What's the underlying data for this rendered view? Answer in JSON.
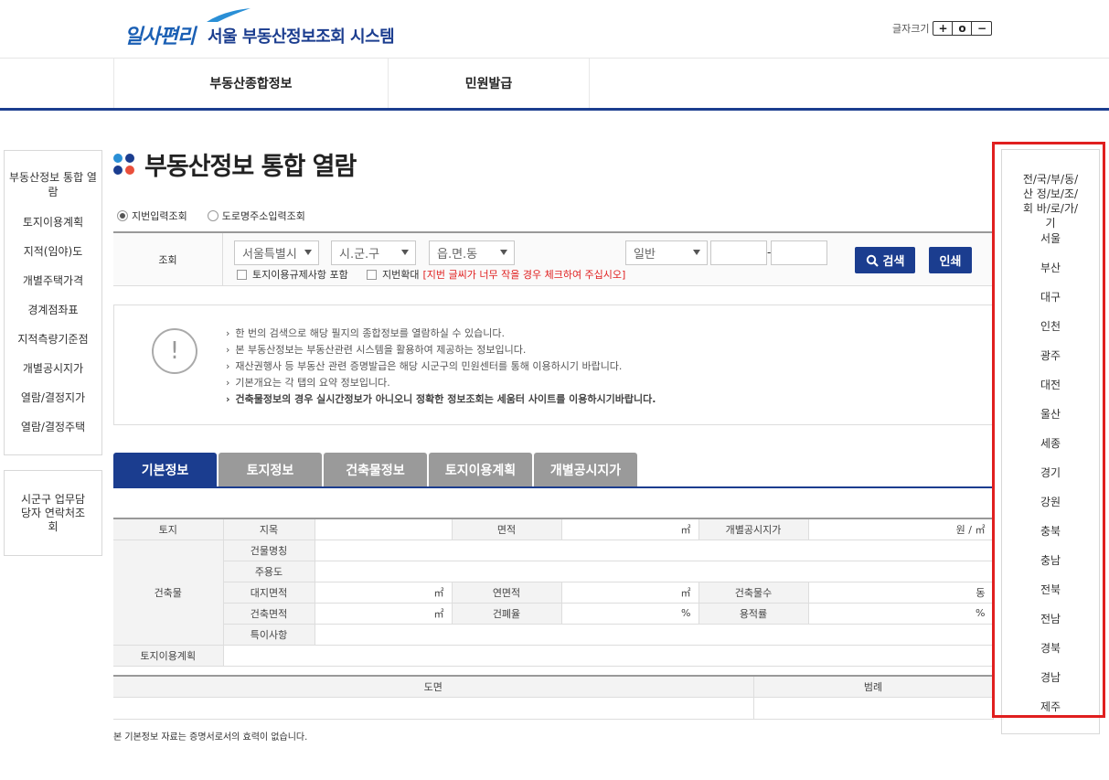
{
  "header": {
    "logo_mark": "일사편리",
    "logo_title": "서울 부동산정보조회 시스템",
    "fontsize_label": "글자크기",
    "fontsize_buttons": [
      "+",
      "o",
      "−"
    ]
  },
  "gnb": [
    "부동산종합정보",
    "민원발급"
  ],
  "lnb": {
    "items": [
      "부동산정보 통합 열람",
      "토지이용계획",
      "지적(임야)도",
      "개별주택가격",
      "경계점좌표",
      "지적측량기준점",
      "개별공시지가",
      "열람/결정지가",
      "열람/결정주택"
    ],
    "contact": "시군구 업무담당자 연락처조회"
  },
  "page_title": "부동산정보 통합 열람",
  "search_mode": {
    "jibun": "지번입력조회",
    "road": "도로명주소입력조회"
  },
  "search": {
    "label": "조회",
    "city": "서울특별시",
    "district": "시.군.구",
    "dong": "읍.면.동",
    "type": "일반",
    "search_button": "검색",
    "print_button": "인쇄",
    "check1": "토지이용규제사항 포함",
    "check2": "지번확대",
    "check2_note": "[지번 글씨가 너무 작을 경우 체크하여 주십시오]"
  },
  "notice": [
    "한 번의 검색으로 해당 필지의 종합정보를 열람하실 수 있습니다.",
    "본 부동산정보는 부동산관련 시스템을 활용하여 제공하는 정보입니다.",
    "재산권행사 등 부동산 관련 증명발급은 해당 시군구의 민원센터를 통해 이용하시기 바랍니다.",
    "기본개요는 각 탭의 요약 정보입니다.",
    "건축물정보의 경우 실시간정보가 아니오니 정확한 정보조회는 세움터 사이트를 이용하시기바랍니다."
  ],
  "tabs": [
    "기본정보",
    "토지정보",
    "건축물정보",
    "토지이용계획",
    "개별공시지가"
  ],
  "table": {
    "land": "토지",
    "jimok": "지목",
    "area": "면적",
    "area_unit": "㎡",
    "price": "개별공시지가",
    "price_unit": "원 / ㎡",
    "building": "건축물",
    "bldg_name": "건물명칭",
    "main_use": "주용도",
    "site_area": "대지면적",
    "site_unit": "㎡",
    "total_area": "연면적",
    "total_unit": "㎡",
    "floors": "건축물수",
    "floors_unit": "동",
    "bldg_area": "건축면적",
    "bldg_unit": "㎡",
    "coverage": "건폐율",
    "coverage_unit": "%",
    "far": "용적률",
    "far_unit": "%",
    "special": "특이사항",
    "land_plan": "토지이용계획",
    "drawing": "도면",
    "legend": "범례"
  },
  "footnote": "본 기본정보 자료는 증명서로서의 효력이 없습니다.",
  "right_panel": {
    "title": "전/국/부/동/산 정/보/조/회 바/로/가/기",
    "regions": [
      "서울",
      "부산",
      "대구",
      "인천",
      "광주",
      "대전",
      "울산",
      "세종",
      "경기",
      "강원",
      "충북",
      "충남",
      "전북",
      "전남",
      "경북",
      "경남",
      "제주"
    ]
  },
  "colors": {
    "primary": "#1b3d8f",
    "tab_inactive": "#9a9a9a",
    "highlight": "#e01f1f"
  }
}
